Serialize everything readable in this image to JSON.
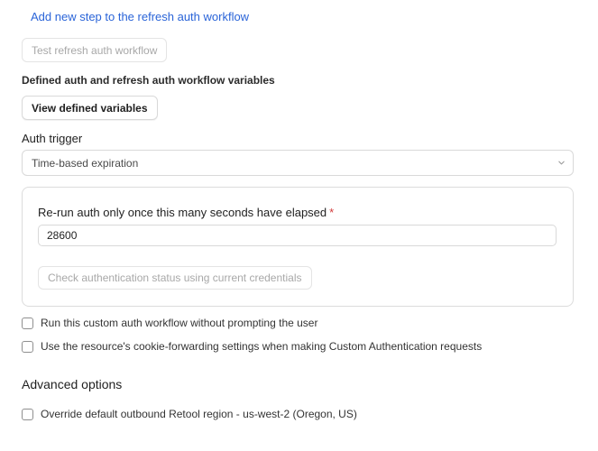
{
  "workflow": {
    "add_step_link": "Add new step to the refresh auth workflow",
    "test_button": "Test refresh auth workflow"
  },
  "variables": {
    "heading": "Defined auth and refresh auth workflow variables",
    "view_button": "View defined variables"
  },
  "auth_trigger": {
    "label": "Auth trigger",
    "selected": "Time-based expiration",
    "icon": "chevron-down-icon"
  },
  "expiration_panel": {
    "rerun_label": "Re-run auth only once this many seconds have elapsed",
    "required_marker": "*",
    "seconds_value": "28600",
    "check_status_button": "Check authentication status using current credentials"
  },
  "options": {
    "run_without_prompt": {
      "label": "Run this custom auth workflow without prompting the user",
      "checked": false
    },
    "cookie_forwarding": {
      "label": "Use the resource's cookie-forwarding settings when making Custom Authentication requests",
      "checked": false
    }
  },
  "advanced": {
    "title": "Advanced options",
    "override_region": {
      "label": "Override default outbound Retool region - us-west-2 (Oregon, US)",
      "checked": false
    }
  },
  "colors": {
    "link": "#2a64d8",
    "required": "#d23b3b",
    "border": "#d9d9d9"
  }
}
